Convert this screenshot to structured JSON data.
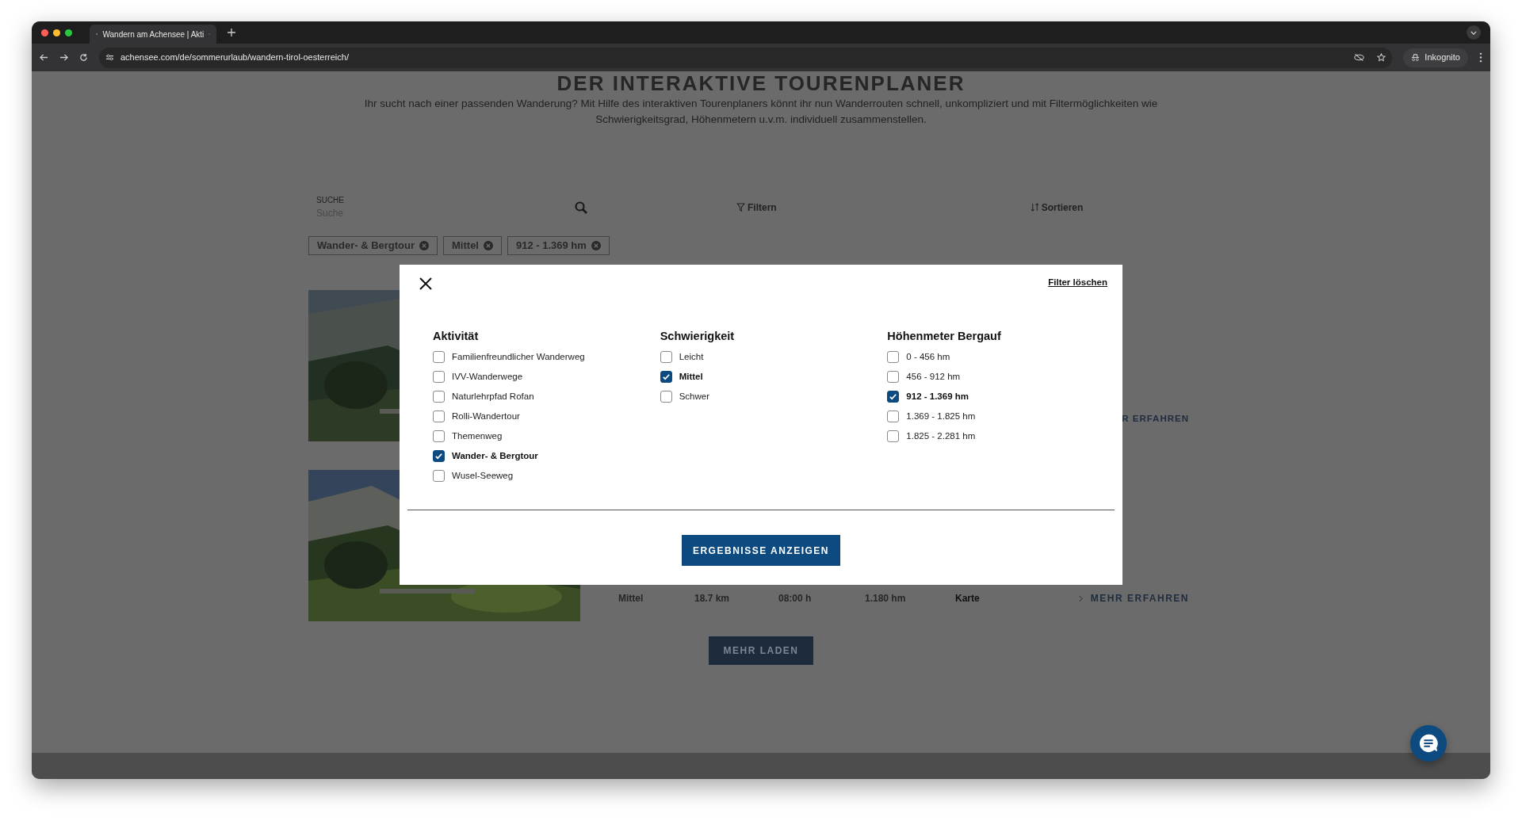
{
  "browser": {
    "tab_title": "Wandern am Achensee | Akti",
    "url": "achensee.com/de/sommerurlaub/wandern-tirol-oesterreich/",
    "profile": "Inkognito"
  },
  "page": {
    "heading": "DER INTERAKTIVE TOURENPLANER",
    "intro": "Ihr sucht nach einer passenden Wanderung? Mit Hilfe des interaktiven Tourenplaners könnt ihr nun Wanderrouten schnell, unkompliziert und mit Filtermöglichkeiten wie Schwierigkeitsgrad, Höhenmetern u.v.m. individuell zusammenstellen.",
    "search": {
      "label": "SUCHE",
      "placeholder": "Suche"
    },
    "filter_button": "Filtern",
    "sort_button": "Sortieren",
    "chips": [
      "Wander- & Bergtour",
      "Mittel",
      "912 - 1.369 hm"
    ],
    "results": [
      {
        "more": "R ERFAHREN"
      },
      {
        "difficulty": "Mittel",
        "distance": "18.7 km",
        "duration": "08:00 h",
        "ascent": "1.180 hm",
        "map": "Karte",
        "more": "MEHR ERFAHREN"
      }
    ],
    "load_more": "MEHR LADEN"
  },
  "modal": {
    "clear": "Filter löschen",
    "groups": [
      {
        "title": "Aktivität",
        "options": [
          {
            "label": "Familienfreundlicher Wanderweg",
            "checked": false
          },
          {
            "label": "IVV-Wanderwege",
            "checked": false
          },
          {
            "label": "Naturlehrpfad Rofan",
            "checked": false
          },
          {
            "label": "Rolli-Wandertour",
            "checked": false
          },
          {
            "label": "Themenweg",
            "checked": false
          },
          {
            "label": "Wander- & Bergtour",
            "checked": true
          },
          {
            "label": "Wusel-Seeweg",
            "checked": false
          }
        ]
      },
      {
        "title": "Schwierigkeit",
        "options": [
          {
            "label": "Leicht",
            "checked": false
          },
          {
            "label": "Mittel",
            "checked": true
          },
          {
            "label": "Schwer",
            "checked": false
          }
        ]
      },
      {
        "title": "Höhenmeter Bergauf",
        "options": [
          {
            "label": "0 - 456 hm",
            "checked": false
          },
          {
            "label": "456 - 912 hm",
            "checked": false
          },
          {
            "label": "912 - 1.369 hm",
            "checked": true
          },
          {
            "label": "1.369 - 1.825 hm",
            "checked": false
          },
          {
            "label": "1.825 - 2.281 hm",
            "checked": false
          }
        ]
      }
    ],
    "submit": "ERGEBNISSE ANZEIGEN"
  }
}
